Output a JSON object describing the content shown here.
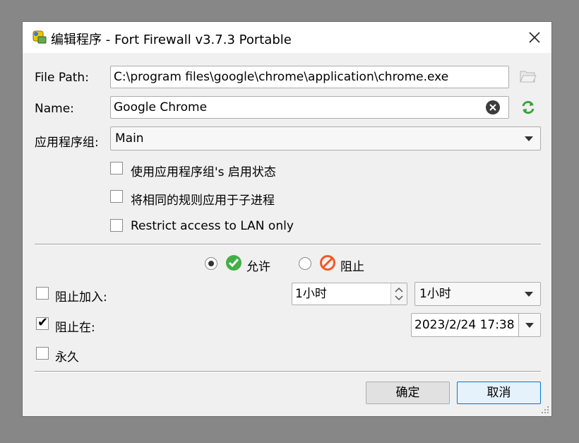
{
  "window": {
    "title": "编辑程序 - Fort Firewall v3.7.3 Portable"
  },
  "file_path": {
    "label": "File Path:",
    "value": "C:\\program files\\google\\chrome\\application\\chrome.exe"
  },
  "name": {
    "label": "Name:",
    "value": "Google Chrome"
  },
  "app_group": {
    "label": "应用程序组:",
    "value": "Main"
  },
  "options": [
    {
      "label": "使用应用程序组's 启用状态",
      "checked": false
    },
    {
      "label": "将相同的规则应用于子进程",
      "checked": false
    },
    {
      "label": "Restrict access to LAN only",
      "checked": false
    }
  ],
  "action": {
    "allow_label": "允许",
    "block_label": "阻止",
    "selected": "allow"
  },
  "block_join": {
    "label": "阻止加入:",
    "checked": false,
    "spin_value": "1小时",
    "combo_value": "1小时"
  },
  "block_at": {
    "label": "阻止在:",
    "checked": true,
    "datetime": "2023/2/24 17:38"
  },
  "forever": {
    "label": "永久",
    "checked": false
  },
  "buttons": {
    "ok": "确定",
    "cancel": "取消"
  },
  "colors": {
    "allow_green": "#43b047",
    "block_orange": "#f05a28",
    "accent": "#0078d7"
  }
}
